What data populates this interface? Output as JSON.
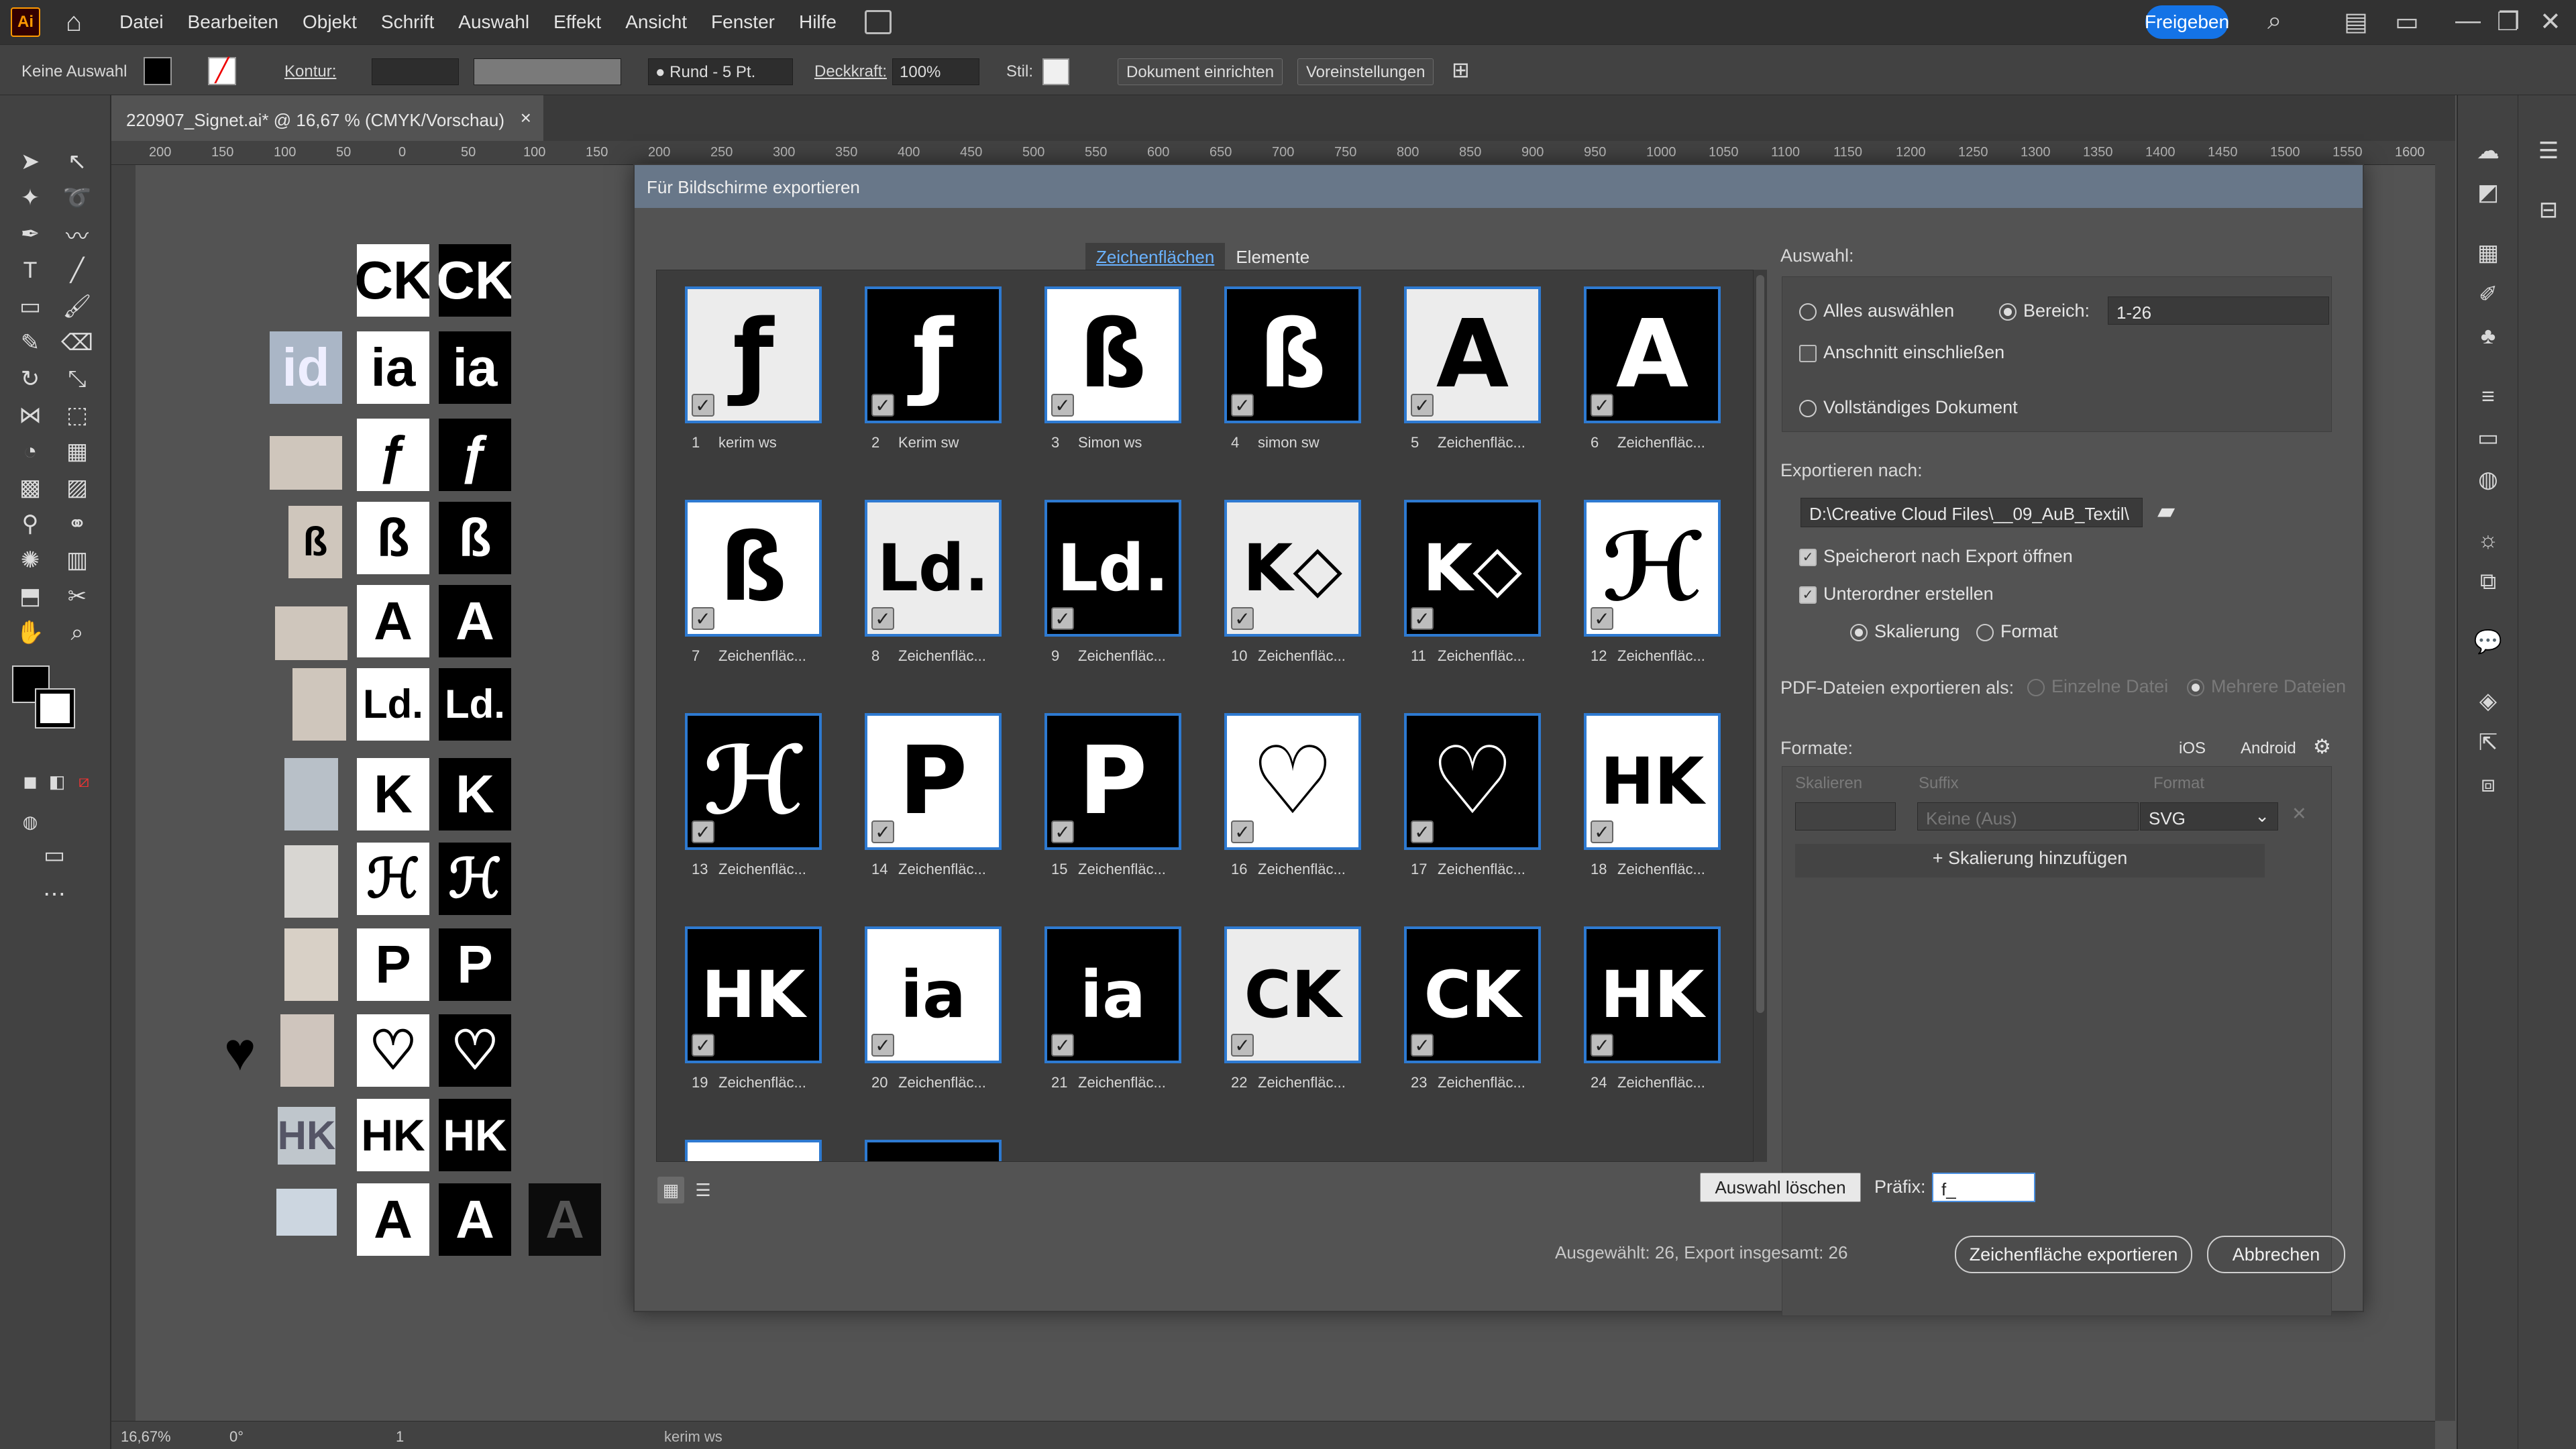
{
  "app": {
    "logo": "Ai",
    "menu": [
      "Datei",
      "Bearbeiten",
      "Objekt",
      "Schrift",
      "Auswahl",
      "Effekt",
      "Ansicht",
      "Fenster",
      "Hilfe"
    ],
    "share_label": "Freigeben"
  },
  "control_bar": {
    "selection": "Keine Auswahl",
    "stroke_label": "Kontur:",
    "brush": "Rund - 5 Pt.",
    "opacity_label": "Deckkraft:",
    "opacity_value": "100%",
    "style_label": "Stil:",
    "doc_setup": "Dokument einrichten",
    "preferences": "Voreinstellungen"
  },
  "document_tab": {
    "title": "220907_Signet.ai* @ 16,67 % (CMYK/Vorschau)",
    "close": "×"
  },
  "ruler_top_labels": [
    "200",
    "150",
    "100",
    "50",
    "0",
    "50",
    "100",
    "150",
    "200",
    "250",
    "300",
    "350",
    "400",
    "450",
    "500",
    "550",
    "600",
    "650",
    "700",
    "750",
    "800",
    "850",
    "900",
    "950",
    "1000",
    "1050",
    "1100",
    "1150",
    "1200",
    "1250",
    "1300",
    "1350",
    "1400",
    "1450",
    "1500",
    "1550",
    "1600"
  ],
  "status_bar": {
    "zoom": "16,67%",
    "rotation": "0°",
    "artboard_num": "1",
    "artboard_name": "kerim ws"
  },
  "dialog": {
    "title": "Für Bildschirme exportieren",
    "tabs": [
      "Zeichenflächen",
      "Elemente"
    ],
    "active_tab": 0,
    "artboards": [
      {
        "num": "1",
        "name": "kerim ws",
        "bg": "light",
        "glyph": "ƒ"
      },
      {
        "num": "2",
        "name": "Kerim sw",
        "bg": "dark",
        "glyph": "ƒ"
      },
      {
        "num": "3",
        "name": "Simon ws",
        "bg": "white",
        "glyph": "ß"
      },
      {
        "num": "4",
        "name": "simon sw",
        "bg": "dark",
        "glyph": "ß"
      },
      {
        "num": "5",
        "name": "Zeichenfläc...",
        "bg": "light",
        "glyph": "A"
      },
      {
        "num": "6",
        "name": "Zeichenfläc...",
        "bg": "dark",
        "glyph": "A"
      },
      {
        "num": "7",
        "name": "Zeichenfläc...",
        "bg": "white",
        "glyph": "ß"
      },
      {
        "num": "8",
        "name": "Zeichenfläc...",
        "bg": "light",
        "glyph": "Ld."
      },
      {
        "num": "9",
        "name": "Zeichenfläc...",
        "bg": "dark",
        "glyph": "Ld."
      },
      {
        "num": "10",
        "name": "Zeichenfläc...",
        "bg": "light",
        "glyph": "K◇"
      },
      {
        "num": "11",
        "name": "Zeichenfläc...",
        "bg": "dark",
        "glyph": "K◇"
      },
      {
        "num": "12",
        "name": "Zeichenfläc...",
        "bg": "white",
        "glyph": "ℋ"
      },
      {
        "num": "13",
        "name": "Zeichenfläc...",
        "bg": "dark",
        "glyph": "ℋ"
      },
      {
        "num": "14",
        "name": "Zeichenfläc...",
        "bg": "white",
        "glyph": "P"
      },
      {
        "num": "15",
        "name": "Zeichenfläc...",
        "bg": "dark",
        "glyph": "P"
      },
      {
        "num": "16",
        "name": "Zeichenfläc...",
        "bg": "white",
        "glyph": "♡"
      },
      {
        "num": "17",
        "name": "Zeichenfläc...",
        "bg": "dark",
        "glyph": "♡"
      },
      {
        "num": "18",
        "name": "Zeichenfläc...",
        "bg": "white",
        "glyph": "HK"
      },
      {
        "num": "19",
        "name": "Zeichenfläc...",
        "bg": "dark",
        "glyph": "HK"
      },
      {
        "num": "20",
        "name": "Zeichenfläc...",
        "bg": "white",
        "glyph": "ia"
      },
      {
        "num": "21",
        "name": "Zeichenfläc...",
        "bg": "dark",
        "glyph": "ia"
      },
      {
        "num": "22",
        "name": "Zeichenfläc...",
        "bg": "light",
        "glyph": "CK"
      },
      {
        "num": "23",
        "name": "Zeichenfläc...",
        "bg": "dark",
        "glyph": "CK"
      },
      {
        "num": "24",
        "name": "Zeichenfläc...",
        "bg": "dark",
        "glyph": "HK"
      }
    ],
    "selection": {
      "title": "Auswahl:",
      "select_all": "Alles auswählen",
      "range_label": "Bereich:",
      "range_value": "1-26",
      "include_bleed": "Anschnitt einschließen",
      "full_document": "Vollständiges Dokument"
    },
    "export_to": {
      "title": "Exportieren nach:",
      "path": "D:\\Creative Cloud Files\\__09_AuB_Textil\\",
      "open_after": "Speicherort nach Export öffnen",
      "create_subfolders": "Unterordner erstellen",
      "by_scale": "Skalierung",
      "by_format": "Format"
    },
    "pdf_export": {
      "label": "PDF-Dateien exportieren als:",
      "single": "Einzelne Datei",
      "multiple": "Mehrere Dateien"
    },
    "formats": {
      "title": "Formate:",
      "ios": "iOS",
      "android": "Android",
      "col_scale": "Skalieren",
      "col_suffix": "Suffix",
      "col_format": "Format",
      "suffix_placeholder": "Keine (Aus)",
      "format_value": "SVG",
      "add_scale": "Skalierung hinzufügen"
    },
    "clear_selection": "Auswahl löschen",
    "prefix_label": "Präfix:",
    "prefix_value": "f_",
    "summary": "Ausgewählt: 26, Export insgesamt: 26",
    "export_button": "Zeichenfläche exportieren",
    "cancel_button": "Abbrechen"
  }
}
